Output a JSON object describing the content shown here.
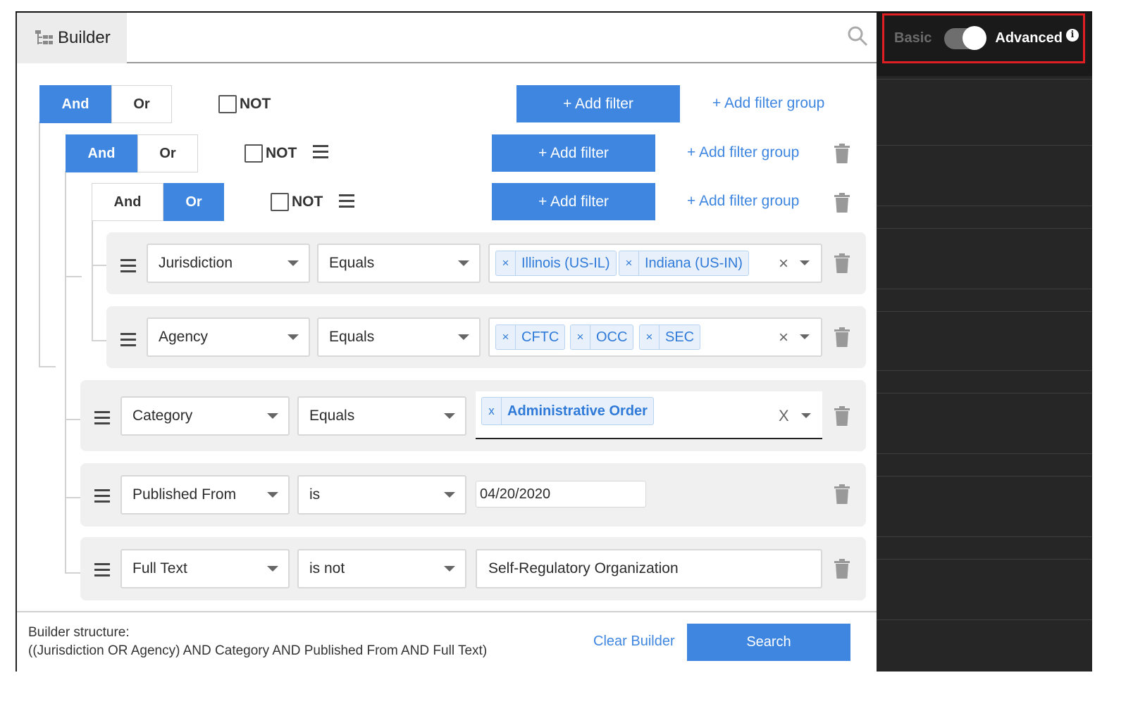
{
  "header": {
    "tab_label": "Builder"
  },
  "mode_toggle": {
    "basic_label": "Basic",
    "advanced_label": "Advanced",
    "info_glyph": "i",
    "advanced_on": true
  },
  "groups": [
    {
      "and_label": "And",
      "or_label": "Or",
      "active": "And",
      "not_label": "NOT",
      "add_filter": "+ Add filter",
      "add_group": "+ Add filter group"
    },
    {
      "and_label": "And",
      "or_label": "Or",
      "active": "And",
      "not_label": "NOT",
      "add_filter": "+ Add filter",
      "add_group": "+ Add filter group"
    },
    {
      "and_label": "And",
      "or_label": "Or",
      "active": "Or",
      "not_label": "NOT",
      "add_filter": "+ Add filter",
      "add_group": "+ Add filter group"
    }
  ],
  "filters": [
    {
      "field": "Jurisdiction",
      "operator": "Equals",
      "chips": [
        "Illinois (US-IL)",
        "Indiana (US-IN)"
      ]
    },
    {
      "field": "Agency",
      "operator": "Equals",
      "chips": [
        "CFTC",
        "OCC",
        "SEC"
      ]
    },
    {
      "field": "Category",
      "operator": "Equals",
      "chips": [
        "Administrative Order"
      ]
    },
    {
      "field": "Published From",
      "operator": "is",
      "value": "04/20/2020"
    },
    {
      "field": "Full Text",
      "operator": "is not",
      "value": "Self-Regulatory Organization"
    }
  ],
  "chip_remove": "×",
  "category_chip_remove": "x",
  "clear_glyph": "×",
  "category_clear_glyph": "X",
  "footer": {
    "structure_label": "Builder structure:",
    "structure_text": "((Jurisdiction OR Agency) AND Category AND Published From AND Full Text)",
    "clear_label": "Clear Builder",
    "search_label": "Search"
  },
  "colors": {
    "accent": "#3e86e0",
    "highlight_border": "#e01e24",
    "dark_panel": "#262626"
  },
  "icons": [
    "builder-tree-icon",
    "search-icon",
    "info-icon",
    "menu-icon",
    "trash-icon",
    "caret-down-icon"
  ]
}
